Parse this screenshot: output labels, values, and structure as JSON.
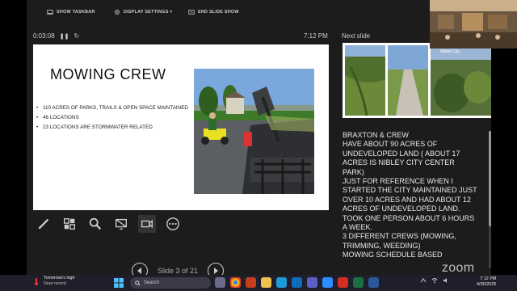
{
  "toolbar": {
    "show_taskbar": "SHOW TASKBAR",
    "display_settings": "DISPLAY SETTINGS ▾",
    "end_slide_show": "END SLIDE SHOW"
  },
  "timer": "0:03:08",
  "clock": "7:12 PM",
  "next_slide_label": "Next slide",
  "slide": {
    "title": "MOWING CREW",
    "bullets": [
      "110 ACRES OF PARKS, TRAILS & OPEN SPACE MAINTAINED",
      "46 LOCATIONS",
      "23 LOCATIONS ARE STORMWATER RELATED"
    ]
  },
  "next_slide_caption": "Nibley City",
  "notes": "BRAXTON & CREW\nHAVE ABOUT 90 ACRES OF UNDEVELOPED LAND ( ABOUT 17 ACRES IS NIBLEY CITY CENTER PARK)\nJUST FOR REFERENCE WHEN I STARTED THE CITY MAINTAINED JUST OVER 10 ACRES AND HAD ABOUT 12 ACRES OF UNDEVELOPED LAND. TOOK ONE PERSON ABOUT 6 HOURS A WEEK.\n3 DIFFERENT CREWS (MOWING, TRIMMING, WEEDING)\nMOWING SCHEDULE BASED",
  "navigation": {
    "slide_counter": "Slide 3 of 21"
  },
  "zoom_logo": "zoom",
  "taskbar": {
    "weather_title": "Tomorrow's high",
    "weather_sub": "Near record",
    "search_placeholder": "Search",
    "time": "7:12 PM",
    "date": "4/30/2025"
  },
  "colors": {
    "presenter_bg": "#1c1c1c",
    "taskbar_bg": "#1f1f2b",
    "slide_bg": "#ffffff"
  }
}
